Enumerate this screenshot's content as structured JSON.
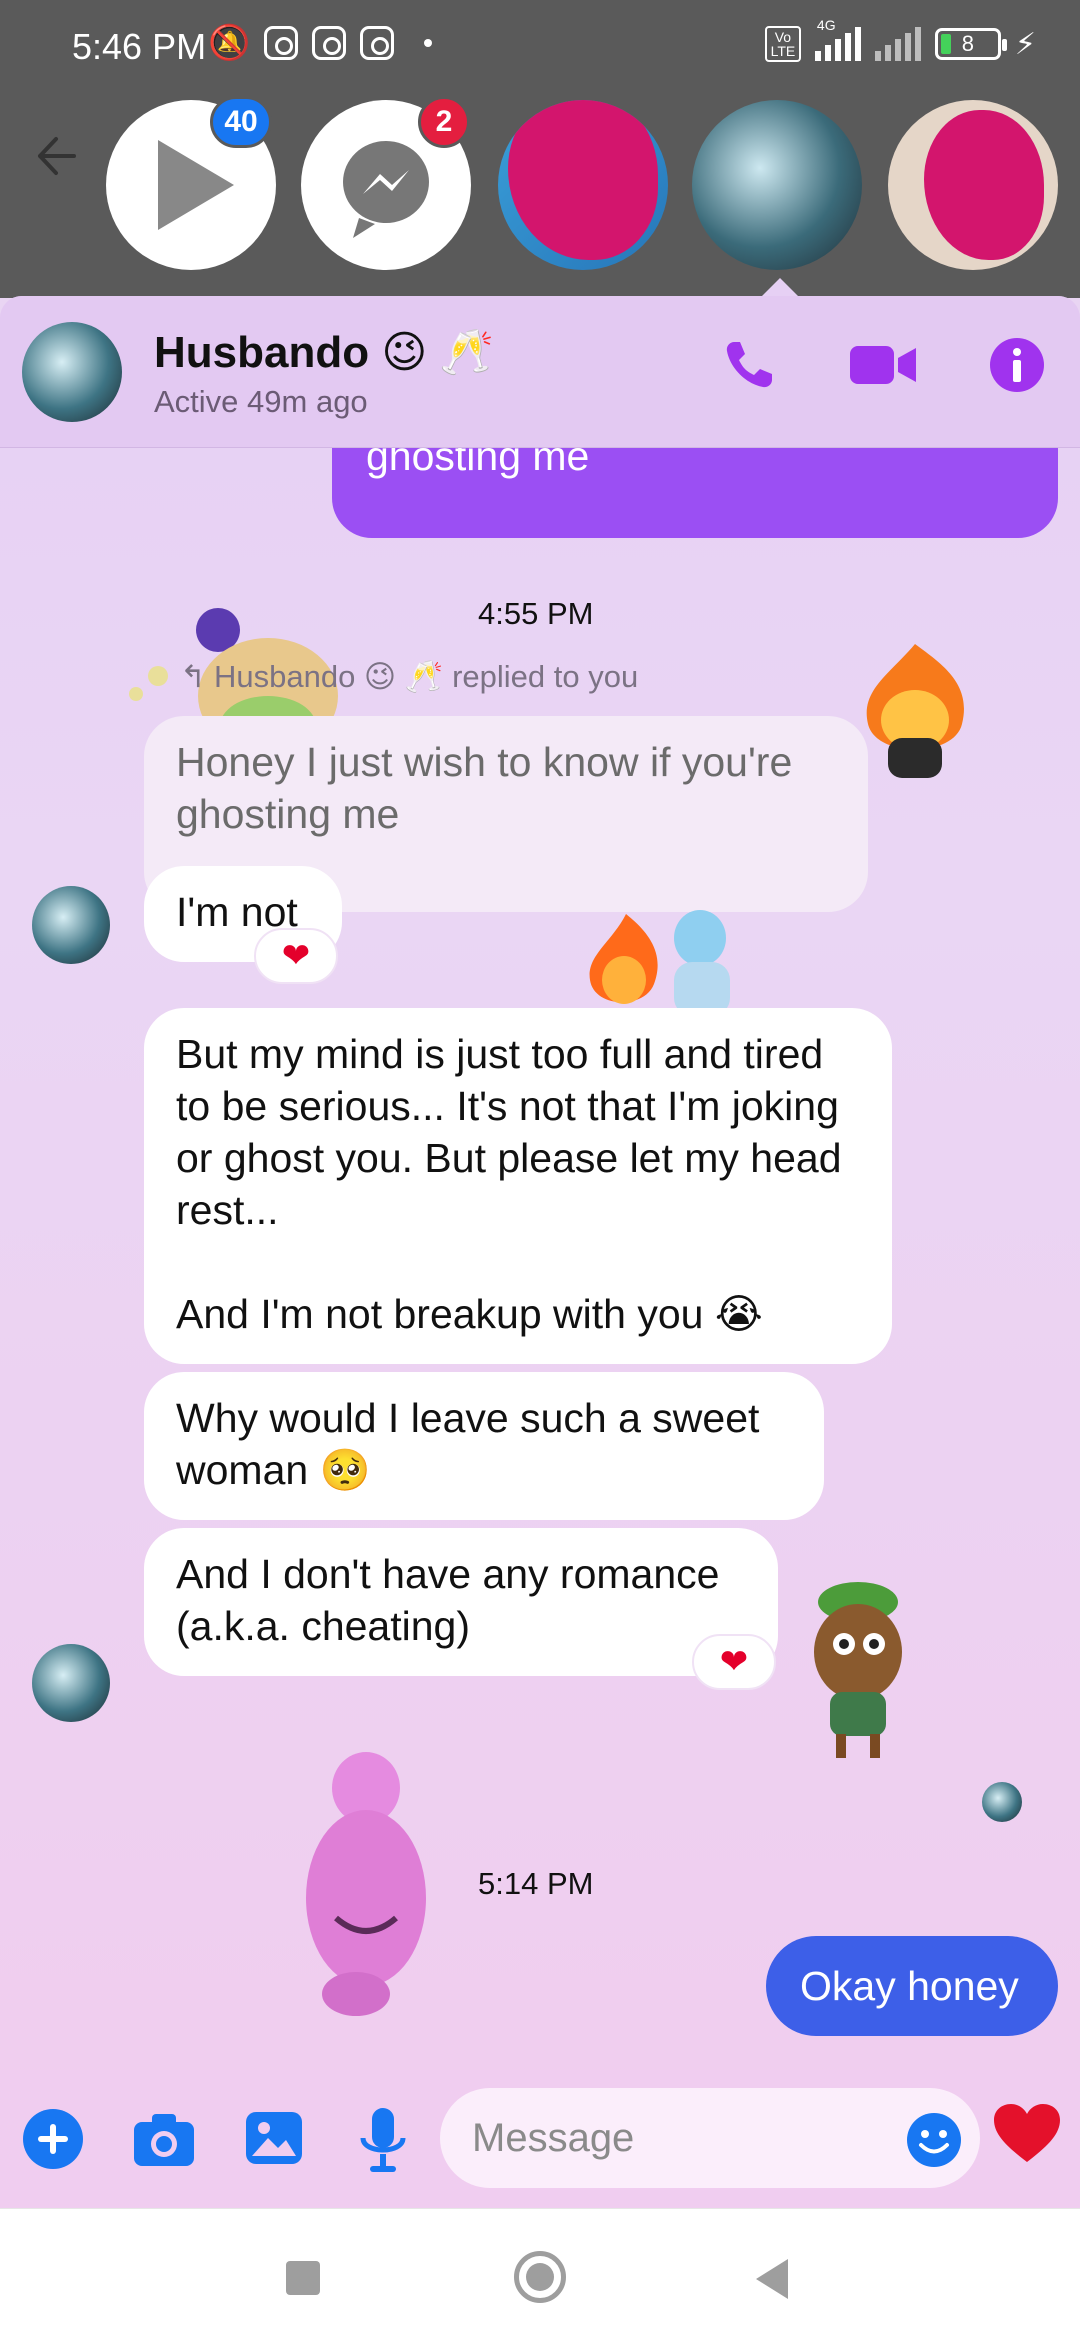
{
  "status_bar": {
    "time": "5:46 PM",
    "network": "4G",
    "volte": "Vo LTE",
    "battery": "8"
  },
  "bubbles": [
    {
      "name": "video-bubble",
      "badge": "40"
    },
    {
      "name": "messenger-bubble",
      "badge": "2"
    },
    {
      "name": "chat-head-3"
    },
    {
      "name": "chat-head-4-active"
    },
    {
      "name": "chat-head-5"
    }
  ],
  "header": {
    "contact_name": "Husbando 😉 🥂",
    "active_status": "Active 49m ago",
    "icons": [
      "phone-icon",
      "video-camera-icon",
      "info-icon"
    ],
    "accent": "#9b4ff3"
  },
  "messages": {
    "sent_1": "Honey I just wish to know if you're ghosting me",
    "time_1": "4:55 PM",
    "reply_note": "Husbando 😉 🥂 replied to you",
    "quoted": "Honey I just wish to know if you're ghosting me",
    "recv_1": "I'm not",
    "recv_1_reaction": "❤",
    "recv_2": "But my mind is just too full and tired to be serious... It's not that I'm joking or ghost you. But please let my head rest...",
    "recv_2b": "And I'm not breakup with you 😭",
    "recv_3": "Why would I leave such a sweet woman 🥺",
    "recv_4": "And I don't have any romance (a.k.a. cheating)",
    "recv_4_reaction": "❤",
    "time_2": "5:14 PM",
    "sent_2": "Okay honey"
  },
  "composer": {
    "placeholder": "Message",
    "icons": [
      "plus-icon",
      "camera-icon",
      "gallery-icon",
      "microphone-icon",
      "emoji-icon",
      "heart-icon"
    ]
  },
  "colors": {
    "sent_bubble": "#9b4ff3",
    "sent_bubble_blue": "#3d5fe8",
    "received_bubble": "#ffffff",
    "icon_purple": "#a033ee",
    "composer_blue": "#1877f2"
  }
}
